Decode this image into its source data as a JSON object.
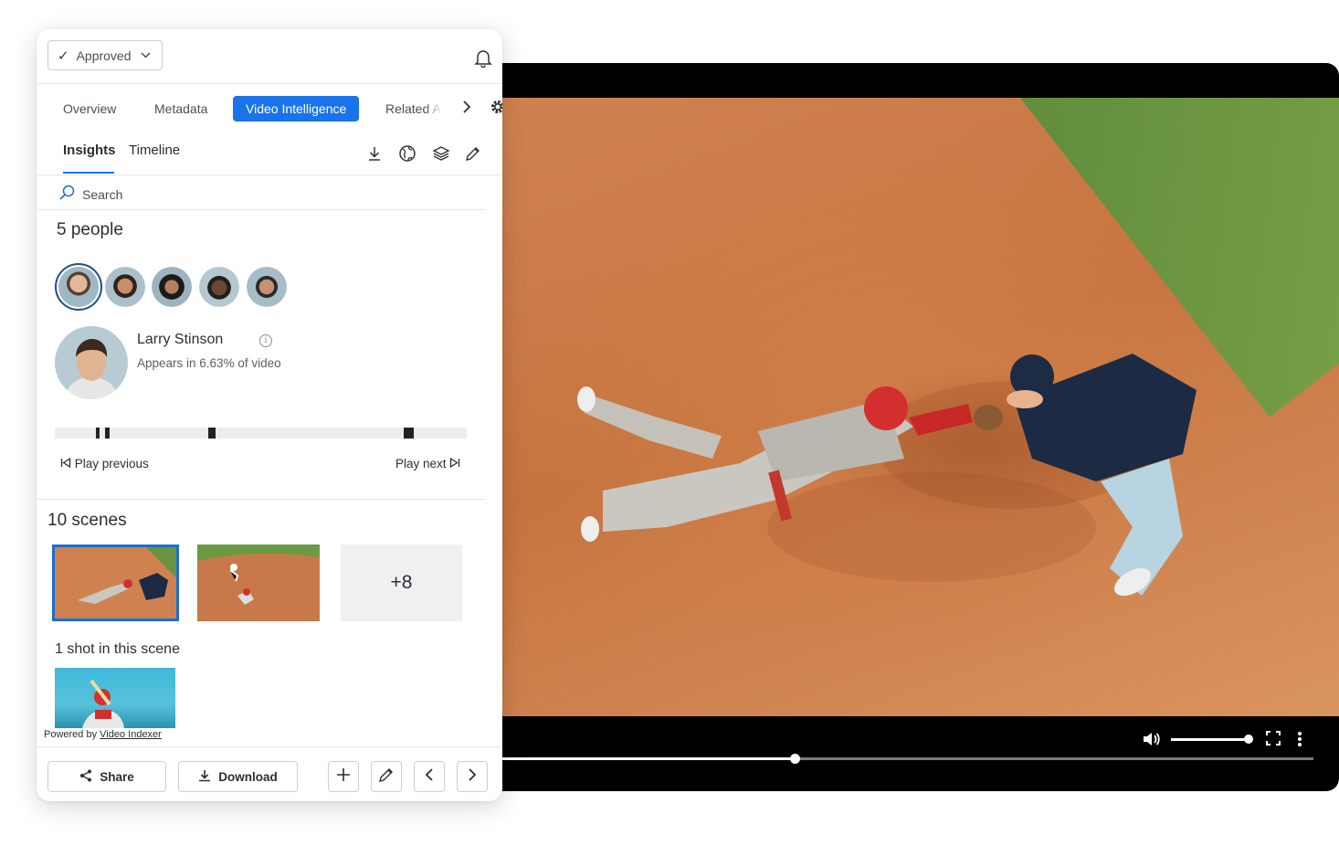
{
  "status": {
    "value": "Approved"
  },
  "tabs": [
    {
      "label": "Overview"
    },
    {
      "label": "Metadata"
    },
    {
      "label": "Video Intelligence"
    },
    {
      "label": "Related A"
    }
  ],
  "subtabs": [
    {
      "label": "Insights"
    },
    {
      "label": "Timeline"
    }
  ],
  "search": {
    "placeholder": "Search"
  },
  "people": {
    "heading": "5 people",
    "selected": {
      "name": "Larry Stinson",
      "appears": "Appears in 6.63% of video"
    },
    "play_previous": "Play previous",
    "play_next": "Play next"
  },
  "scenes": {
    "heading": "10 scenes",
    "more": "+8",
    "shot_heading": "1 shot in this scene"
  },
  "powered": {
    "prefix": "Powered by",
    "link": "Video Indexer"
  },
  "footer": {
    "share": "Share",
    "download": "Download"
  },
  "player": {
    "progress": 0.36,
    "volume": 1.0
  },
  "colors": {
    "accent": "#1a73e8",
    "selected_border": "#1e4f8f"
  },
  "icons": [
    "check-icon",
    "chevron-down-icon",
    "bell-icon",
    "chevron-right-icon",
    "gear-icon",
    "download-icon",
    "globe-icon",
    "layers-icon",
    "pencil-icon",
    "search-icon",
    "info-icon",
    "skip-previous-icon",
    "skip-next-icon",
    "share-icon",
    "plus-icon",
    "chevron-left-icon",
    "volume-icon",
    "fullscreen-icon",
    "more-vertical-icon"
  ]
}
